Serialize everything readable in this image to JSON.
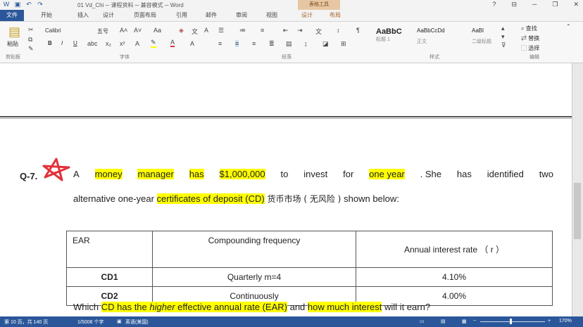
{
  "window": {
    "title": "01 Vd_Chi ─ 课程资料 ─ 兼容模式 ─ Word",
    "context_tab": "表格工具",
    "min": "─",
    "restore": "❐",
    "close": "✕",
    "help": "?"
  },
  "tabs": [
    "文件",
    "开始",
    "插入",
    "设计",
    "页面布局",
    "引用",
    "邮件",
    "审阅",
    "视图",
    "设计",
    "布局"
  ],
  "ribbon": {
    "paste": "粘贴",
    "font_name": "Calibri",
    "font_size": "五号",
    "bold": "B",
    "italic": "I",
    "underline": "U",
    "styles": [
      {
        "preview": "AaBbC",
        "label": "标题 1"
      },
      {
        "preview": "AaBbCcDd",
        "label": "正文"
      },
      {
        "preview": "AaBl",
        "label": "二级标题"
      }
    ],
    "find": "查找",
    "replace": "替换",
    "select": "选择",
    "groups": {
      "clipboard": "剪贴板",
      "font": "字体",
      "paragraph": "段落",
      "styles": "样式",
      "editing": "编辑"
    }
  },
  "document": {
    "q_label": "Q-7.",
    "line1": [
      {
        "t": "A",
        "hl": false
      },
      {
        "t": "money",
        "hl": true
      },
      {
        "t": "manager",
        "hl": true
      },
      {
        "t": "has",
        "hl": true
      },
      {
        "t": "$1,000,000",
        "hl": true
      },
      {
        "t": "to",
        "hl": false
      },
      {
        "t": "invest",
        "hl": false
      },
      {
        "t": "for",
        "hl": false
      },
      {
        "t": "one year",
        "hl": true
      },
      {
        "t": ". She",
        "hl": false
      },
      {
        "t": "has",
        "hl": false
      },
      {
        "t": "identified",
        "hl": false
      },
      {
        "t": "two",
        "hl": false
      }
    ],
    "line2_a": "alternative one-year ",
    "line2_hl": "certificates of deposit (CD)",
    "line2_cjk": " 货币市场 ( 无风险 ) ",
    "line2_b": "shown below:",
    "table": {
      "headers": [
        "EAR",
        "Compounding frequency",
        "Annual interest rate （ r ）"
      ],
      "rows": [
        [
          "CD1",
          "Quarterly m=4",
          "4.10%"
        ],
        [
          "CD2",
          "Continuously",
          "4.00%"
        ]
      ]
    },
    "line3": [
      {
        "t": "Which ",
        "hl": false
      },
      {
        "t": "CD has the ",
        "hl": true
      },
      {
        "t": "higher",
        "hl": true,
        "it": true
      },
      {
        "t": " effective annual rate (EAR)",
        "hl": true
      },
      {
        "t": " and ",
        "hl": false
      },
      {
        "t": "how much interest",
        "hl": true
      },
      {
        "t": " will it earn?",
        "hl": false
      }
    ]
  },
  "status": {
    "page": "第 10 页，共 140 页",
    "words": "1/5008 个字",
    "lang": "英语(美国)",
    "zoom": "170%"
  },
  "colors": {
    "accent": "#2b579a",
    "highlight": "#ffff00",
    "mark": "#e2313a"
  }
}
